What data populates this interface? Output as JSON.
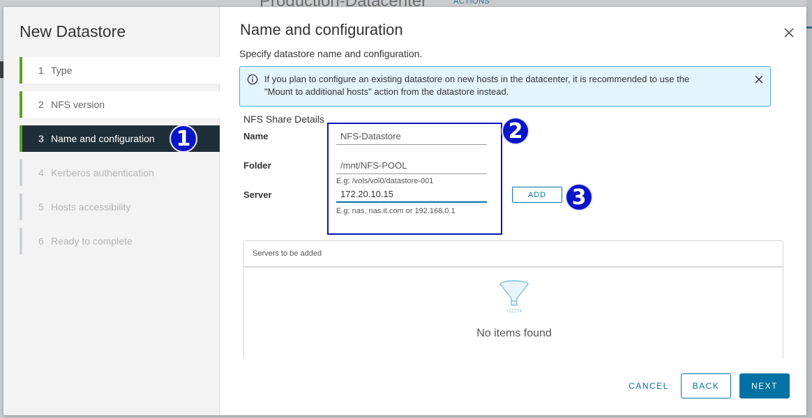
{
  "background": {
    "title": "Production-Datacenter",
    "actions_label": "ACTIONS"
  },
  "wizard": {
    "title": "New Datastore",
    "steps": [
      {
        "num": "1",
        "label": "Type"
      },
      {
        "num": "2",
        "label": "NFS version"
      },
      {
        "num": "3",
        "label": "Name and configuration"
      },
      {
        "num": "4",
        "label": "Kerberos authentication"
      },
      {
        "num": "5",
        "label": "Hosts accessibility"
      },
      {
        "num": "6",
        "label": "Ready to complete"
      }
    ],
    "active_step": 3
  },
  "page": {
    "title": "Name and configuration",
    "subtitle": "Specify datastore name and configuration.",
    "alert": {
      "line1": "If you plan to configure an existing datastore on new hosts in the datacenter, it is recommended to use the",
      "line2": "\"Mount to additional hosts\" action from the datastore instead."
    },
    "section_title": "NFS Share Details",
    "fields": {
      "name": {
        "label": "Name",
        "value": "NFS-Datastore"
      },
      "folder": {
        "label": "Folder",
        "value": "/mnt/NFS-POOL",
        "helper": "E.g: /vols/vol0/datastore-001"
      },
      "server": {
        "label": "Server",
        "value": "172.20.10.15",
        "helper": "E.g: nas, nas.it.com or 192.168.0.1"
      }
    },
    "add_label": "ADD",
    "grid": {
      "header": "Servers to be added",
      "empty_text": "No items found"
    }
  },
  "annotations": [
    "1",
    "2",
    "3"
  ],
  "footer": {
    "cancel": "CANCEL",
    "back": "BACK",
    "next": "NEXT"
  },
  "colors": {
    "accent": "#0072a3",
    "active_step_bg": "#1f2f38",
    "complete_step": "#5aa220",
    "alert_bg": "#e3f5fc",
    "annotation": "#0a14c8"
  }
}
